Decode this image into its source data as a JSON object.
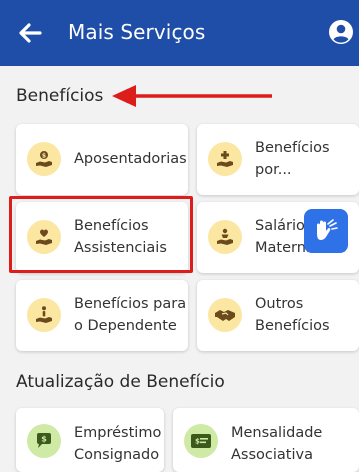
{
  "header": {
    "title": "Mais Serviços",
    "background": "#1f4ea8"
  },
  "sections": [
    {
      "title": "Benefícios",
      "cards": [
        {
          "label_lines": [
            "Aposentadorias"
          ],
          "icon": "hand-coin-icon",
          "icon_bg": "#fbe6a2"
        },
        {
          "label_lines": [
            "Benefícios",
            "por..."
          ],
          "icon": "hand-plus-icon",
          "icon_bg": "#fbe6a2"
        },
        {
          "label_lines": [
            "Benefícios",
            "Assistenciais"
          ],
          "icon": "hand-heart-icon",
          "icon_bg": "#fbe6a2"
        },
        {
          "label_lines": [
            "Salário-",
            "Maternidade"
          ],
          "icon": "hand-baby-icon",
          "icon_bg": "#fbe6a2"
        },
        {
          "label_lines": [
            "Benefícios para",
            "o Dependente"
          ],
          "icon": "hand-person-icon",
          "icon_bg": "#fbe6a2"
        },
        {
          "label_lines": [
            "Outros",
            "Benefícios"
          ],
          "icon": "handshake-icon",
          "icon_bg": "#fbe6a2"
        }
      ]
    },
    {
      "title": "Atualização de Benefício",
      "cards": [
        {
          "label_lines": [
            "Empréstimo",
            "Consignado"
          ],
          "icon": "money-chat-icon",
          "icon_bg": "#cfeaa5"
        },
        {
          "label_lines": [
            "Mensalidade",
            "Associativa"
          ],
          "icon": "card-icon",
          "icon_bg": "#cfeaa5"
        }
      ]
    }
  ],
  "annotations": {
    "arrow_color": "#dd1c1c",
    "highlight_color": "#dd1c1c"
  },
  "accessibility_button": {
    "icon": "sign-language-icon",
    "color": "#2f72e8"
  }
}
